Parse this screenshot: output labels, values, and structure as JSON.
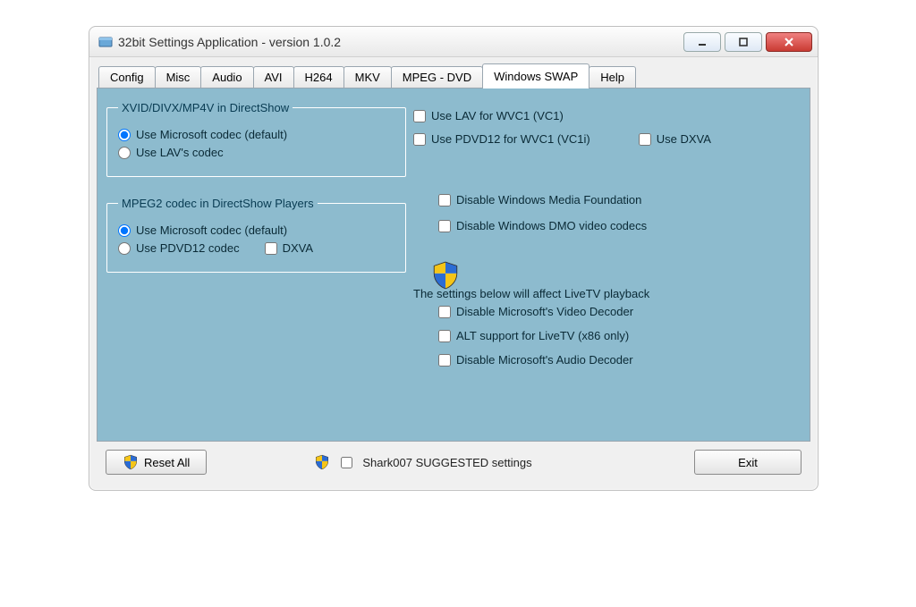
{
  "window": {
    "title": "32bit Settings Application - version 1.0.2"
  },
  "tabs": [
    "Config",
    "Misc",
    "Audio",
    "AVI",
    "H264",
    "MKV",
    "MPEG - DVD",
    "Windows SWAP",
    "Help"
  ],
  "activeTab": "Windows SWAP",
  "group1": {
    "legend": "XVID/DIVX/MP4V in DirectShow",
    "opt_ms": "Use Microsoft codec (default)",
    "opt_lav": "Use LAV's codec"
  },
  "group2": {
    "legend": "MPEG2 codec in DirectShow Players",
    "opt_ms": "Use Microsoft codec (default)",
    "opt_pdvd": "Use PDVD12 codec",
    "dxva": "DXVA"
  },
  "right": {
    "lav_wvc1": "Use LAV for WVC1 (VC1)",
    "pdvd_wvc1": "Use PDVD12 for WVC1 (VC1i)",
    "dxva": "Use DXVA",
    "dis_wmf": "Disable Windows Media Foundation",
    "dis_dmo": "Disable Windows DMO video codecs",
    "livetv_header": "The settings below will affect LiveTV playback",
    "dis_ms_vid": "Disable Microsoft's Video Decoder",
    "alt_livetv": "ALT support for LiveTV (x86 only)",
    "dis_ms_aud": "Disable Microsoft's Audio Decoder"
  },
  "bottom": {
    "reset": "Reset All",
    "suggested": "Shark007 SUGGESTED settings",
    "exit": "Exit"
  }
}
